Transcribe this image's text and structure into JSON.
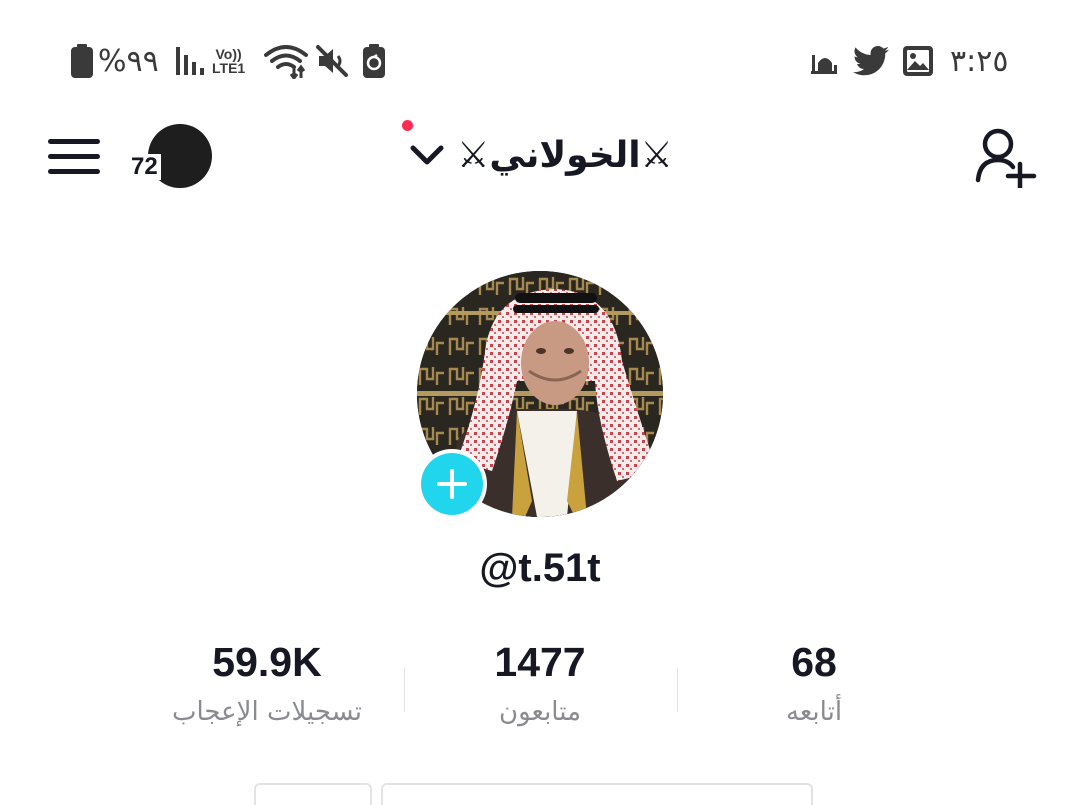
{
  "status_bar": {
    "time": "٣:٢٥",
    "battery_percent": "%٩٩",
    "network_label_top": "Vo))",
    "network_label_bottom": "LTE1",
    "icons": [
      "battery-icon",
      "signal-icon",
      "wifi-icon",
      "mute-icon",
      "battery-saver-icon",
      "mosque-icon",
      "twitter-icon",
      "gallery-icon"
    ]
  },
  "header": {
    "story_count": "72",
    "username": "⚔الخولاني⚔",
    "icons": [
      "menu-icon",
      "chevron-down-icon",
      "add-friend-icon"
    ]
  },
  "profile": {
    "handle": "@t.51t"
  },
  "stats": {
    "likes": {
      "value": "59.9K",
      "label": "تسجيلات الإعجاب"
    },
    "followers": {
      "value": "1477",
      "label": "متابعون"
    },
    "following": {
      "value": "68",
      "label": "أتابعه"
    }
  },
  "colors": {
    "accent_cyan": "#20d5ec",
    "notification_red": "#fe2c55",
    "text_primary": "#161823",
    "text_secondary": "#8a8b91"
  }
}
